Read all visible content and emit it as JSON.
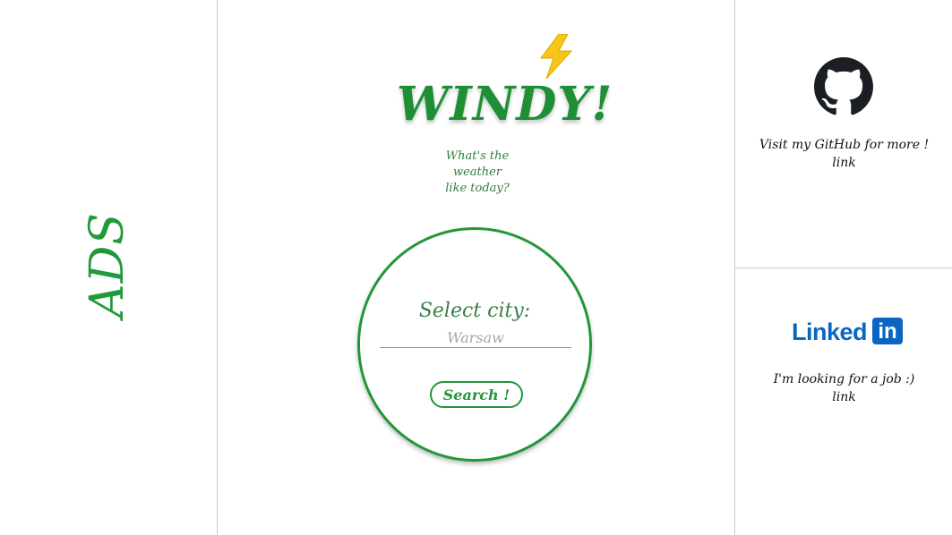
{
  "ads": {
    "label": "ADS"
  },
  "header": {
    "title": "WINDY!",
    "subtitle_line1": "What's the weather",
    "subtitle_line2": "like today?"
  },
  "form": {
    "label": "Select city:",
    "city_placeholder": "Warsaw",
    "city_value": "",
    "search_label": "Search !"
  },
  "github": {
    "text": "Visit my GitHub for more !",
    "link_label": "link",
    "icon": "github-icon"
  },
  "linkedin": {
    "logo_word": "Linked",
    "logo_box": "in",
    "text": "I'm looking for a job :)",
    "link_label": "link",
    "icon": "linkedin-logo"
  },
  "colors": {
    "accent": "#23963a",
    "title": "#1e8f35",
    "bolt": "#f5c518",
    "linkedin": "#0a66c2",
    "divider": "#c8c8c8"
  }
}
